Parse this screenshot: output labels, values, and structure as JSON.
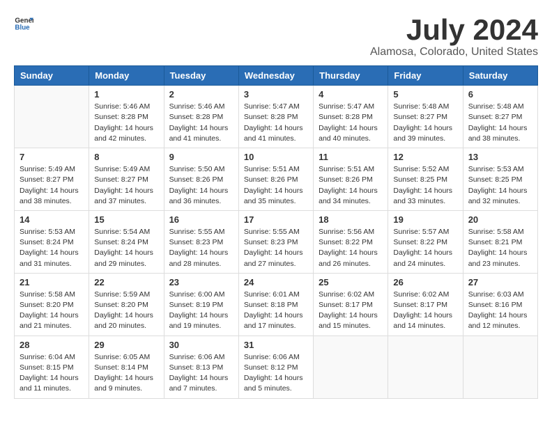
{
  "logo": {
    "general": "General",
    "blue": "Blue"
  },
  "title": "July 2024",
  "location": "Alamosa, Colorado, United States",
  "weekdays": [
    "Sunday",
    "Monday",
    "Tuesday",
    "Wednesday",
    "Thursday",
    "Friday",
    "Saturday"
  ],
  "weeks": [
    [
      {
        "day": "",
        "info": ""
      },
      {
        "day": "1",
        "info": "Sunrise: 5:46 AM\nSunset: 8:28 PM\nDaylight: 14 hours\nand 42 minutes."
      },
      {
        "day": "2",
        "info": "Sunrise: 5:46 AM\nSunset: 8:28 PM\nDaylight: 14 hours\nand 41 minutes."
      },
      {
        "day": "3",
        "info": "Sunrise: 5:47 AM\nSunset: 8:28 PM\nDaylight: 14 hours\nand 41 minutes."
      },
      {
        "day": "4",
        "info": "Sunrise: 5:47 AM\nSunset: 8:28 PM\nDaylight: 14 hours\nand 40 minutes."
      },
      {
        "day": "5",
        "info": "Sunrise: 5:48 AM\nSunset: 8:27 PM\nDaylight: 14 hours\nand 39 minutes."
      },
      {
        "day": "6",
        "info": "Sunrise: 5:48 AM\nSunset: 8:27 PM\nDaylight: 14 hours\nand 38 minutes."
      }
    ],
    [
      {
        "day": "7",
        "info": "Sunrise: 5:49 AM\nSunset: 8:27 PM\nDaylight: 14 hours\nand 38 minutes."
      },
      {
        "day": "8",
        "info": "Sunrise: 5:49 AM\nSunset: 8:27 PM\nDaylight: 14 hours\nand 37 minutes."
      },
      {
        "day": "9",
        "info": "Sunrise: 5:50 AM\nSunset: 8:26 PM\nDaylight: 14 hours\nand 36 minutes."
      },
      {
        "day": "10",
        "info": "Sunrise: 5:51 AM\nSunset: 8:26 PM\nDaylight: 14 hours\nand 35 minutes."
      },
      {
        "day": "11",
        "info": "Sunrise: 5:51 AM\nSunset: 8:26 PM\nDaylight: 14 hours\nand 34 minutes."
      },
      {
        "day": "12",
        "info": "Sunrise: 5:52 AM\nSunset: 8:25 PM\nDaylight: 14 hours\nand 33 minutes."
      },
      {
        "day": "13",
        "info": "Sunrise: 5:53 AM\nSunset: 8:25 PM\nDaylight: 14 hours\nand 32 minutes."
      }
    ],
    [
      {
        "day": "14",
        "info": "Sunrise: 5:53 AM\nSunset: 8:24 PM\nDaylight: 14 hours\nand 31 minutes."
      },
      {
        "day": "15",
        "info": "Sunrise: 5:54 AM\nSunset: 8:24 PM\nDaylight: 14 hours\nand 29 minutes."
      },
      {
        "day": "16",
        "info": "Sunrise: 5:55 AM\nSunset: 8:23 PM\nDaylight: 14 hours\nand 28 minutes."
      },
      {
        "day": "17",
        "info": "Sunrise: 5:55 AM\nSunset: 8:23 PM\nDaylight: 14 hours\nand 27 minutes."
      },
      {
        "day": "18",
        "info": "Sunrise: 5:56 AM\nSunset: 8:22 PM\nDaylight: 14 hours\nand 26 minutes."
      },
      {
        "day": "19",
        "info": "Sunrise: 5:57 AM\nSunset: 8:22 PM\nDaylight: 14 hours\nand 24 minutes."
      },
      {
        "day": "20",
        "info": "Sunrise: 5:58 AM\nSunset: 8:21 PM\nDaylight: 14 hours\nand 23 minutes."
      }
    ],
    [
      {
        "day": "21",
        "info": "Sunrise: 5:58 AM\nSunset: 8:20 PM\nDaylight: 14 hours\nand 21 minutes."
      },
      {
        "day": "22",
        "info": "Sunrise: 5:59 AM\nSunset: 8:20 PM\nDaylight: 14 hours\nand 20 minutes."
      },
      {
        "day": "23",
        "info": "Sunrise: 6:00 AM\nSunset: 8:19 PM\nDaylight: 14 hours\nand 19 minutes."
      },
      {
        "day": "24",
        "info": "Sunrise: 6:01 AM\nSunset: 8:18 PM\nDaylight: 14 hours\nand 17 minutes."
      },
      {
        "day": "25",
        "info": "Sunrise: 6:02 AM\nSunset: 8:17 PM\nDaylight: 14 hours\nand 15 minutes."
      },
      {
        "day": "26",
        "info": "Sunrise: 6:02 AM\nSunset: 8:17 PM\nDaylight: 14 hours\nand 14 minutes."
      },
      {
        "day": "27",
        "info": "Sunrise: 6:03 AM\nSunset: 8:16 PM\nDaylight: 14 hours\nand 12 minutes."
      }
    ],
    [
      {
        "day": "28",
        "info": "Sunrise: 6:04 AM\nSunset: 8:15 PM\nDaylight: 14 hours\nand 11 minutes."
      },
      {
        "day": "29",
        "info": "Sunrise: 6:05 AM\nSunset: 8:14 PM\nDaylight: 14 hours\nand 9 minutes."
      },
      {
        "day": "30",
        "info": "Sunrise: 6:06 AM\nSunset: 8:13 PM\nDaylight: 14 hours\nand 7 minutes."
      },
      {
        "day": "31",
        "info": "Sunrise: 6:06 AM\nSunset: 8:12 PM\nDaylight: 14 hours\nand 5 minutes."
      },
      {
        "day": "",
        "info": ""
      },
      {
        "day": "",
        "info": ""
      },
      {
        "day": "",
        "info": ""
      }
    ]
  ]
}
